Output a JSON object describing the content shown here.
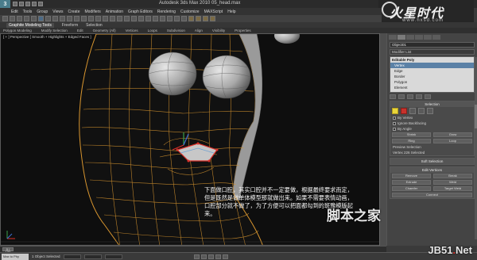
{
  "titlebar": {
    "app_button": "3",
    "title": "Autodesk 3ds Max 2010    05_head.max"
  },
  "brand": {
    "name": "火星时代",
    "url": "www.hxsd.com"
  },
  "menus": [
    "Edit",
    "Tools",
    "Group",
    "Views",
    "Create",
    "Modifiers",
    "Animation",
    "Graph Editors",
    "Rendering",
    "Customize",
    "MAXScript",
    "Help"
  ],
  "ribbon": {
    "tabs": [
      "Graphite Modeling Tools",
      "Freeform",
      "Selection"
    ],
    "subtabs": [
      "Polygon Modeling",
      "Modify Selection",
      "Edit",
      "Geometry (All)",
      "Vertices",
      "Loops",
      "Subdivision",
      "Align",
      "Visibility",
      "Properties"
    ]
  },
  "viewport": {
    "label": "[ + ] Perspective [ Smooth + Highlights + Edged Faces ]",
    "annotation": "下面做口腔，其实口腔并不一定要做，根据最终要求而定，但是既然是做单体模型那就做出来。如果不需要表情动画，口腔部分就不做了，为了方便可以把面都勾到的斑豫模版起来。"
  },
  "panel": {
    "object_name": "Object01",
    "modifier_list": "Modifier List",
    "stack": {
      "root": "Editable Poly",
      "items": [
        "Vertex",
        "Edge",
        "Border",
        "Polygon",
        "Element"
      ],
      "selected_index": 0
    },
    "selection": {
      "title": "Selection",
      "by_vertex": "By Vertex",
      "ignore_backfacing": "Ignore Backfacing",
      "by_angle": "By Angle",
      "shrink": "Shrink",
      "grow": "Grow",
      "ring": "Ring",
      "loop": "Loop",
      "preview": "Preview Selection",
      "status": "Vertex 226 Selected"
    },
    "soft_selection": {
      "title": "Soft Selection"
    },
    "edit_vertices": {
      "title": "Edit Vertices",
      "remove": "Remove",
      "break": "Break",
      "extrude": "Extrude",
      "weld": "Weld",
      "chamfer": "Chamfer",
      "target_weld": "Target Weld",
      "connect": "Connect"
    }
  },
  "timeline": {
    "slider": "0 / 100"
  },
  "status": {
    "maxscript": "Max to Phy",
    "message": "1 Object Selected"
  },
  "watermark_cn": "脚本之家",
  "watermark_site": {
    "prefix": "JB51",
    "dot": ".",
    "suffix": "Net"
  }
}
